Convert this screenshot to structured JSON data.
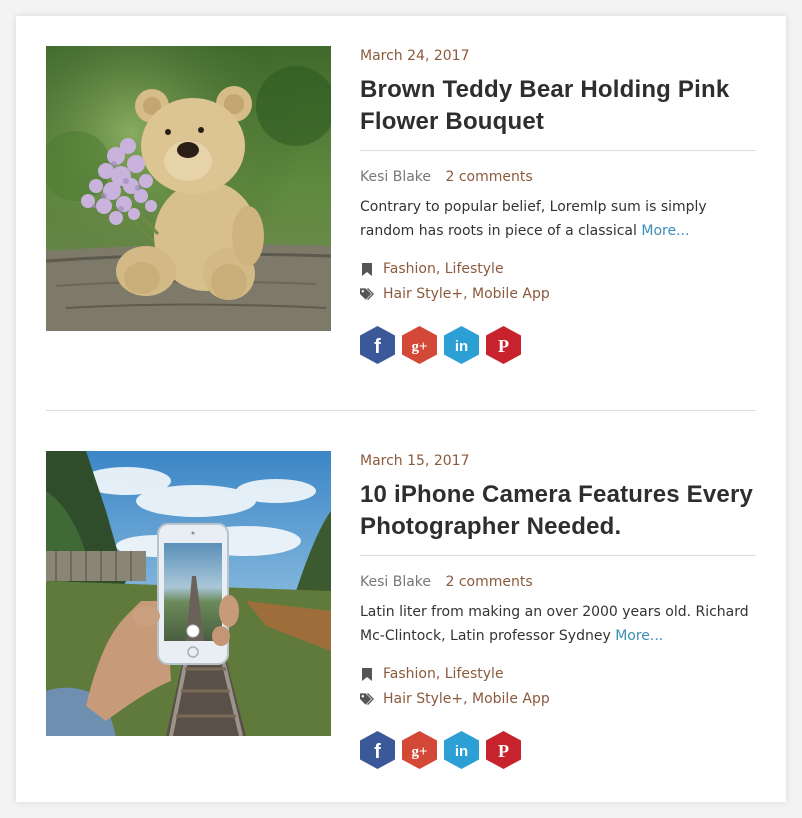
{
  "posts": [
    {
      "date": "March 24, 2017",
      "title": "Brown Teddy Bear Holding Pink Flower Bouquet",
      "author": "Kesi Blake",
      "comments": "2 comments",
      "excerpt": "Contrary to popular belief, LoremIp sum is simply random has roots in piece of a classical",
      "more": "More...",
      "categories": [
        "Fashion",
        "Lifestyle"
      ],
      "tags": [
        "Hair Style+",
        "Mobile App"
      ],
      "image": "teddy-bear-photo"
    },
    {
      "date": "March 15, 2017",
      "title": "10 iPhone Camera Features Every Photographer Needed.",
      "author": "Kesi Blake",
      "comments": "2 comments",
      "excerpt": "Latin liter from making an over 2000 years old. Richard Mc-Clintock, Latin professor Sydney",
      "more": "More...",
      "categories": [
        "Fashion",
        "Lifestyle"
      ],
      "tags": [
        "Hair Style+",
        "Mobile App"
      ],
      "image": "phone-railway-photo"
    }
  ],
  "social": [
    {
      "name": "facebook",
      "glyph": "f",
      "color": "#3b5998"
    },
    {
      "name": "google-plus",
      "glyph": "g+",
      "color": "#d34836"
    },
    {
      "name": "linkedin",
      "glyph": "in",
      "color": "#2c9fd4"
    },
    {
      "name": "pinterest",
      "glyph": "P",
      "color": "#c8232c"
    }
  ],
  "colors": {
    "accent_brown": "#8b5a3c",
    "link_blue": "#3a8fb7",
    "title_dark": "#2e2e2e",
    "rule": "#dcdcdc"
  }
}
